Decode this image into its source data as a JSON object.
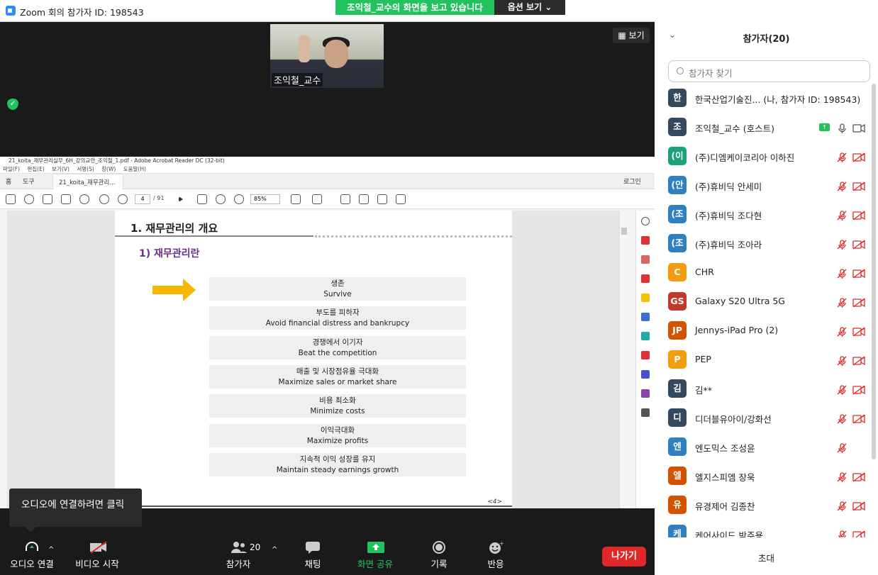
{
  "window": {
    "title": "Zoom 회의 참가자 ID: 198543",
    "minimize": "─",
    "maximize": "☐",
    "close": "✕"
  },
  "banner": {
    "sharing_text": "조익철_교수의 화면을 보고 있습니다",
    "options_label": "옵션 보기 ⌄"
  },
  "stage": {
    "video_label": "조익철_교수",
    "view_button": "보기"
  },
  "acrobat": {
    "title": "21_koita_재무관리실무_6H_강의교안_조익철_1.pdf - Adobe Acrobat Reader DC (32-bit)",
    "menu": [
      "파일(F)",
      "편집(E)",
      "보기(V)",
      "서명(S)",
      "창(W)",
      "도움말(H)"
    ],
    "tabs": {
      "home": "홈",
      "tools": "도구",
      "doc": "21_koita_재무관리...",
      "login": "로그인"
    },
    "page_current": "4",
    "page_total": "/ 91",
    "zoom": "85%"
  },
  "slide": {
    "heading": "1. 재무관리의 개요",
    "subheading": "1) 재무관리란",
    "goals": [
      {
        "ko": "생존",
        "en": "Survive"
      },
      {
        "ko": "부도를 피하자",
        "en": "Avoid financial distress and bankrupcy"
      },
      {
        "ko": "경쟁에서 이기자",
        "en": "Beat the competition"
      },
      {
        "ko": "매출 및 시장점유율 극대화",
        "en": "Maximize sales or market share"
      },
      {
        "ko": "비용 최소화",
        "en": "Minimize costs"
      },
      {
        "ko": "이익극대화",
        "en": "Maximize profits"
      },
      {
        "ko": "지속적 이익 성장를 유지",
        "en": "Maintain steady earnings growth"
      }
    ],
    "page_num": "<4>"
  },
  "toolbar": {
    "tooltip": "오디오에 연결하려면 클릭",
    "audio": "오디오 연결",
    "video": "비디오 시작",
    "participants": "참가자",
    "participants_count": "20",
    "chat": "채팅",
    "share": "화면 공유",
    "record": "기록",
    "reactions": "반응",
    "leave": "나가기"
  },
  "panel": {
    "title": "참가자(20)",
    "search_placeholder": "참가자 찾기",
    "invite": "초대",
    "participants": [
      {
        "initial": "한",
        "name": "한국산업기술진...   (나, 참가자 ID: 198543)",
        "color": "#34495e",
        "mic": "none",
        "cam": "none"
      },
      {
        "initial": "조",
        "name": "조익철_교수 (호스트)",
        "color": "#34495e",
        "mic": "on",
        "cam": "on"
      },
      {
        "initial": "(이",
        "name": "(주)디엠케이코리아 이하진",
        "color": "#1aa37a",
        "mic": "muted",
        "cam": "off"
      },
      {
        "initial": "(안",
        "name": "(주)휴비딕 안세미",
        "color": "#2f80c0",
        "mic": "muted",
        "cam": "off"
      },
      {
        "initial": "(조",
        "name": "(주)휴비딕 조다현",
        "color": "#2f80c0",
        "mic": "muted",
        "cam": "off"
      },
      {
        "initial": "(조",
        "name": "(주)휴비딕 조아라",
        "color": "#2f80c0",
        "mic": "muted",
        "cam": "off"
      },
      {
        "initial": "C",
        "name": "CHR",
        "color": "#f39c12",
        "mic": "muted",
        "cam": "off"
      },
      {
        "initial": "GS",
        "name": "Galaxy S20 Ultra 5G",
        "color": "#c0392b",
        "mic": "muted",
        "cam": "off"
      },
      {
        "initial": "JP",
        "name": "Jennys-iPad Pro (2)",
        "color": "#d35400",
        "mic": "muted",
        "cam": "off"
      },
      {
        "initial": "P",
        "name": "PEP",
        "color": "#f39c12",
        "mic": "muted",
        "cam": "off"
      },
      {
        "initial": "김",
        "name": "김**",
        "color": "#34495e",
        "mic": "muted",
        "cam": "off"
      },
      {
        "initial": "디",
        "name": "디더블유아이/강화선",
        "color": "#34495e",
        "mic": "muted",
        "cam": "off"
      },
      {
        "initial": "엔",
        "name": "엔도믹스 조성윤",
        "color": "#2f80c0",
        "mic": "muted",
        "cam": "none"
      },
      {
        "initial": "엘",
        "name": "엘지스피엠 장욱",
        "color": "#d35400",
        "mic": "muted",
        "cam": "off"
      },
      {
        "initial": "유",
        "name": "유경제어 김종찬",
        "color": "#d35400",
        "mic": "muted",
        "cam": "off"
      },
      {
        "initial": "케",
        "name": "케어사이드 박주용",
        "color": "#2f80c0",
        "mic": "muted",
        "cam": "off"
      }
    ]
  },
  "colors": {
    "share_green": "#23c25f",
    "leave_red": "#e02828",
    "muted_red": "#e02828",
    "heading_purple": "#6b2f8a",
    "arrow_yellow": "#f5b700"
  }
}
